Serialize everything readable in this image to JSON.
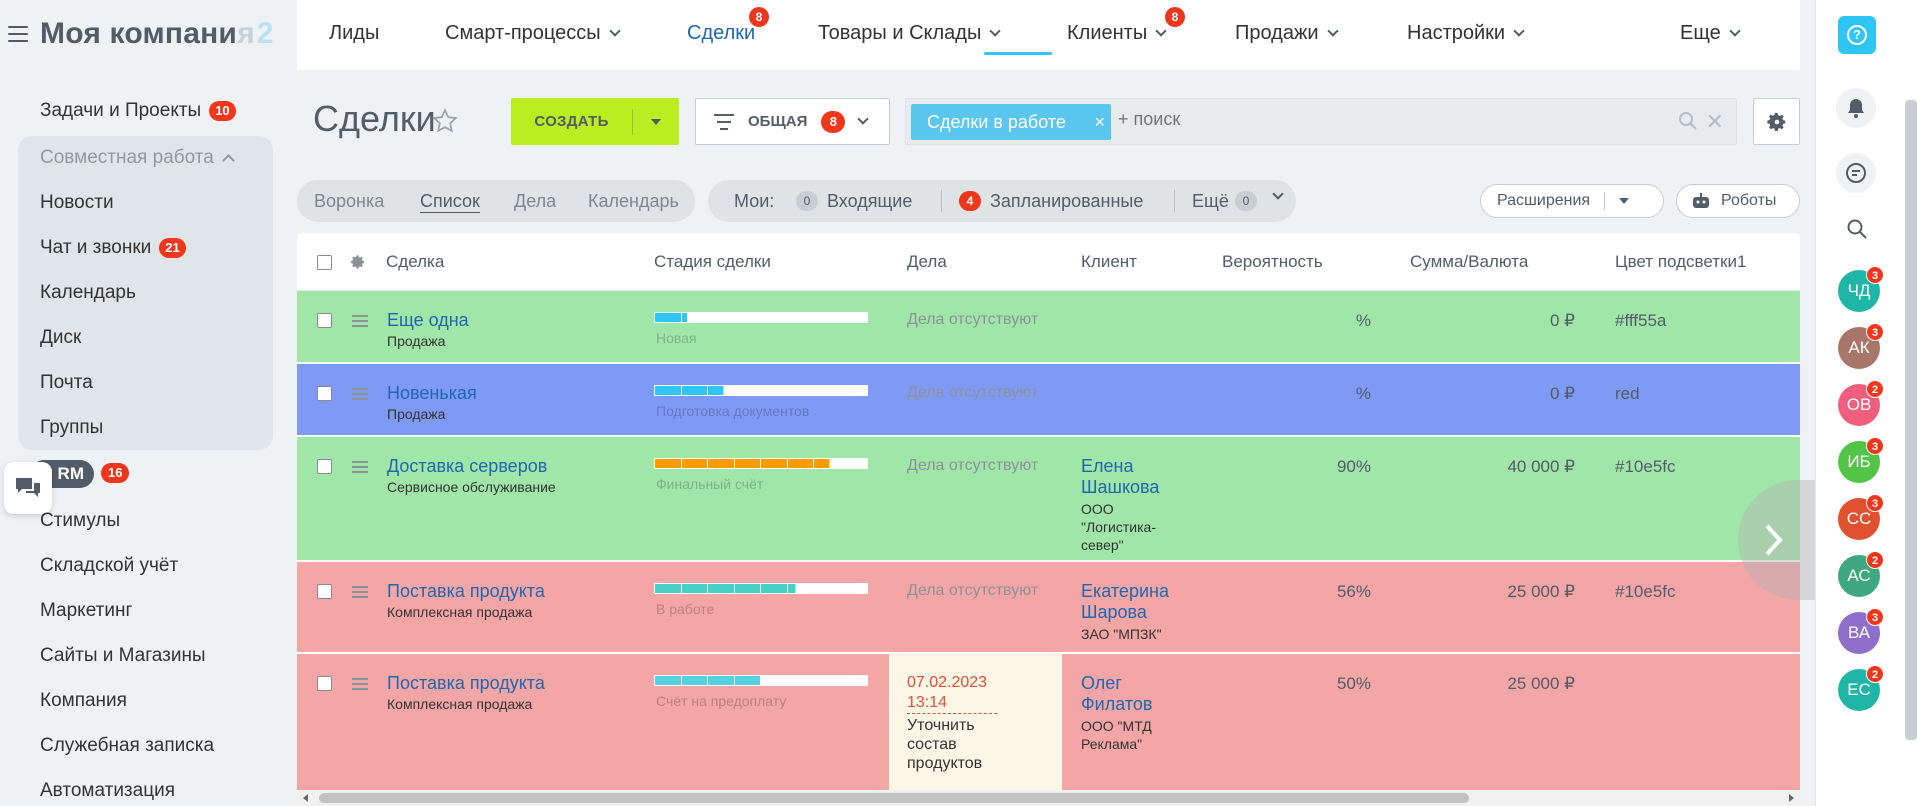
{
  "sidebar": {
    "logo": "Моя компани",
    "logo_fade": "я",
    "logo_num": "2",
    "items": [
      {
        "label": "Задачи и Проекты",
        "badge": "10"
      },
      {
        "label": "Совместная работа"
      },
      {
        "label": "Новости"
      },
      {
        "label": "Чат и звонки",
        "badge": "21"
      },
      {
        "label": "Календарь"
      },
      {
        "label": "Диск"
      },
      {
        "label": "Почта"
      },
      {
        "label": "Группы"
      },
      {
        "label": "RM",
        "badge": "16"
      },
      {
        "label": "Стимулы"
      },
      {
        "label": "Складской учёт"
      },
      {
        "label": "Маркетинг"
      },
      {
        "label": "Сайты и Магазины"
      },
      {
        "label": "Компания"
      },
      {
        "label": "Служебная записка"
      },
      {
        "label": "Автоматизация"
      }
    ]
  },
  "topnav": {
    "items": [
      {
        "label": "Лиды"
      },
      {
        "label": "Смарт-процессы"
      },
      {
        "label": "Сделки",
        "badge": "8"
      },
      {
        "label": "Товары и Склады"
      },
      {
        "label": "Клиенты",
        "badge": "8"
      },
      {
        "label": "Продажи"
      },
      {
        "label": "Настройки"
      },
      {
        "label": "Еще"
      }
    ]
  },
  "header": {
    "title": "Сделки",
    "create_label": "СОЗДАТЬ",
    "filter_label": "ОБЩАЯ",
    "filter_badge": "8",
    "search_tag": "Сделки в работе",
    "search_placeholder": "+ поиск"
  },
  "views": {
    "tabs": [
      "Воронка",
      "Список",
      "Дела",
      "Календарь"
    ],
    "my_label": "Мои:",
    "incoming_count": "0",
    "incoming_label": "Входящие",
    "planned_count": "4",
    "planned_label": "Запланированные",
    "more_label": "Ещё",
    "more_count": "0",
    "extensions_label": "Расширения",
    "robots_label": "Роботы"
  },
  "grid": {
    "columns": [
      "Сделка",
      "Стадия сделки",
      "Дела",
      "Клиент",
      "Вероятность",
      "Сумма/Валюта",
      "Цвет подсветки1"
    ],
    "rows": [
      {
        "title": "Еще одна",
        "sub": "Продажа",
        "stage": "Новая",
        "stage_fill": 0.15,
        "stage_color": "#2fc6f6",
        "acts": "Дела отсутствуют",
        "client": "",
        "client_co": "",
        "prob": "%",
        "sum": "0 ₽",
        "color": "#fff55a",
        "bg": "#a0e6a8"
      },
      {
        "title": "Новенькая",
        "sub": "Продажа",
        "stage": "Подготовка документов",
        "stage_fill": 0.33,
        "stage_color": "#2fc6f6",
        "acts": "Дела отсутствуют",
        "client": "",
        "client_co": "",
        "prob": "%",
        "sum": "0 ₽",
        "color": "red",
        "bg": "#7f9af5"
      },
      {
        "title": "Доставка серверов",
        "sub": "Сервисное обслуживание",
        "stage": "Финальный счёт",
        "stage_fill": 0.83,
        "stage_color": "#ff9a00",
        "acts": "Дела отсутствуют",
        "client": "Елена Шашкова",
        "client_co": "ООО \"Логистика-север\"",
        "prob": "90%",
        "sum": "40 000 ₽",
        "color": "#10e5fc",
        "bg": "#a0e6a8"
      },
      {
        "title": "Поставка продукта",
        "sub": "Комплексная продажа",
        "stage": "В работе",
        "stage_fill": 0.66,
        "stage_color": "#47d1c4",
        "acts": "Дела отсутствуют",
        "client": "Екатерина Шарова",
        "client_co": "ЗАО \"МПЗК\"",
        "prob": "56%",
        "sum": "25 000 ₽",
        "color": "#10e5fc",
        "bg": "#f4a5a5"
      },
      {
        "title": "Поставка продукта",
        "sub": "Комплексная продажа",
        "stage": "Счёт на предоплату",
        "stage_fill": 0.5,
        "stage_color": "#55d0e0",
        "acts_date": "07.02.2023 13:14",
        "acts_text": "Уточнить состав продуктов",
        "client": "Олег Филатов",
        "client_co": "ООО \"МТД Реклама\"",
        "prob": "50%",
        "sum": "25 000 ₽",
        "color": "",
        "bg": "#f4a5a5"
      }
    ]
  },
  "rightbar": {
    "help": "?",
    "avatars": [
      {
        "initials": "ЧД",
        "badge": "3",
        "color": "#1fb6a8"
      },
      {
        "initials": "АК",
        "badge": "3",
        "color": "#a8776a"
      },
      {
        "initials": "ОВ",
        "badge": "2",
        "color": "#f05e7e"
      },
      {
        "initials": "ИБ",
        "badge": "3",
        "color": "#52c546"
      },
      {
        "initials": "СС",
        "badge": "3",
        "color": "#e0512f"
      },
      {
        "initials": "АС",
        "badge": "2",
        "color": "#3fa880"
      },
      {
        "initials": "ВА",
        "badge": "3",
        "color": "#8e6fcc"
      },
      {
        "initials": "ЕС",
        "badge": "2",
        "color": "#1fb6a8"
      }
    ]
  }
}
